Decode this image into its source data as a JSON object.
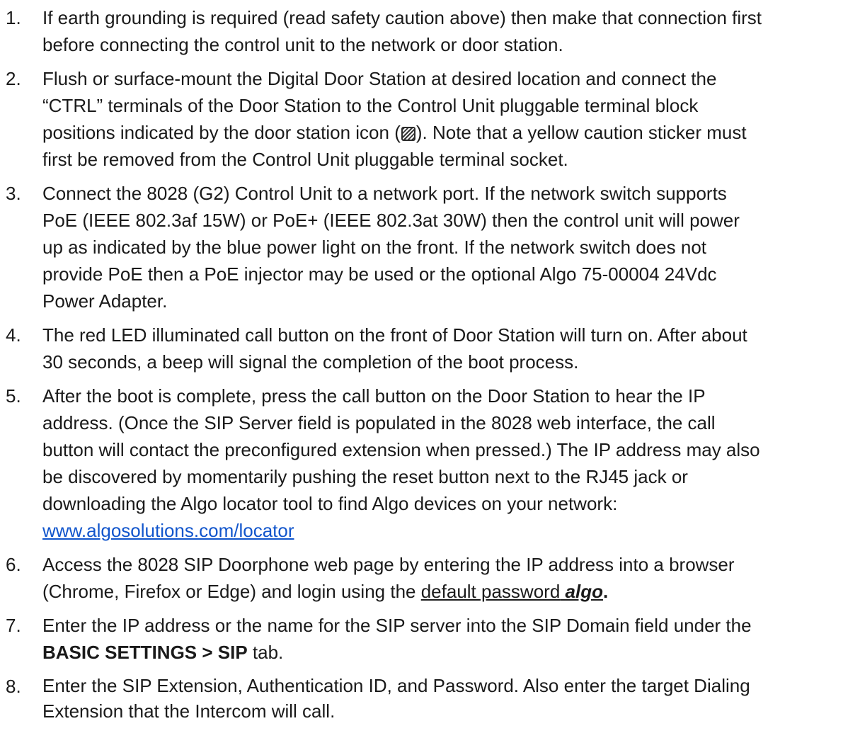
{
  "steps": [
    {
      "number": "1.",
      "lines": [
        "If earth grounding is required (read safety caution above) then make that connection first",
        "before connecting the control unit to the network or door station."
      ]
    },
    {
      "number": "2.",
      "lines": [
        "Flush or surface-mount the Digital Door Station at desired location and connect the",
        "“CTRL” terminals of the Door Station to the Control Unit pluggable terminal block"
      ],
      "icon_line_before": "positions indicated by the door station icon (",
      "icon_name": "door-station-icon",
      "icon_line_after": "). Note that a yellow caution sticker must",
      "last_line": "first be removed from the Control Unit pluggable terminal socket."
    },
    {
      "number": "3.",
      "lines": [
        "Connect the 8028 (G2) Control Unit to a network port. If the network switch supports",
        "PoE (IEEE 802.3af 15W) or PoE+ (IEEE 802.3at 30W) then the control unit will power",
        "up as indicated by the blue power light on the front. If the network switch does not",
        "provide PoE then a PoE injector may be used or the optional Algo 75-00004 24Vdc",
        "Power Adapter."
      ]
    },
    {
      "number": "4.",
      "lines": [
        "The red LED illuminated call button on the front of Door Station will turn on. After about",
        "30 seconds, a beep will signal the completion of the boot process."
      ]
    },
    {
      "number": "5.",
      "lines": [
        "After the boot is complete, press the call button on the Door Station to hear the IP",
        "address. (Once the SIP Server field is populated in the 8028 web interface, the call",
        "button will contact the preconfigured extension when pressed.) The IP address may also",
        "be discovered by momentarily pushing the reset button next to the RJ45 jack or",
        "downloading the Algo locator tool to find Algo devices on your network:"
      ],
      "link": "www.algosolutions.com/locator"
    },
    {
      "number": "6.",
      "line1": "Access the 8028 SIP Doorphone web page by entering the IP address into a browser",
      "line2_prefix": "(Chrome, Firefox or Edge) and login using the ",
      "underlined": "default password",
      "space": " ",
      "password": "algo",
      "period": "."
    },
    {
      "number": "7.",
      "line1": "Enter the IP address or the name for the SIP server into the SIP Domain field under the",
      "bold": "BASIC SETTINGS > SIP",
      "suffix": " tab."
    },
    {
      "number": "8.",
      "lines": [
        "Enter the SIP Extension, Authentication ID, and Password. Also enter the target Dialing",
        "Extension that the Intercom will call."
      ]
    }
  ]
}
